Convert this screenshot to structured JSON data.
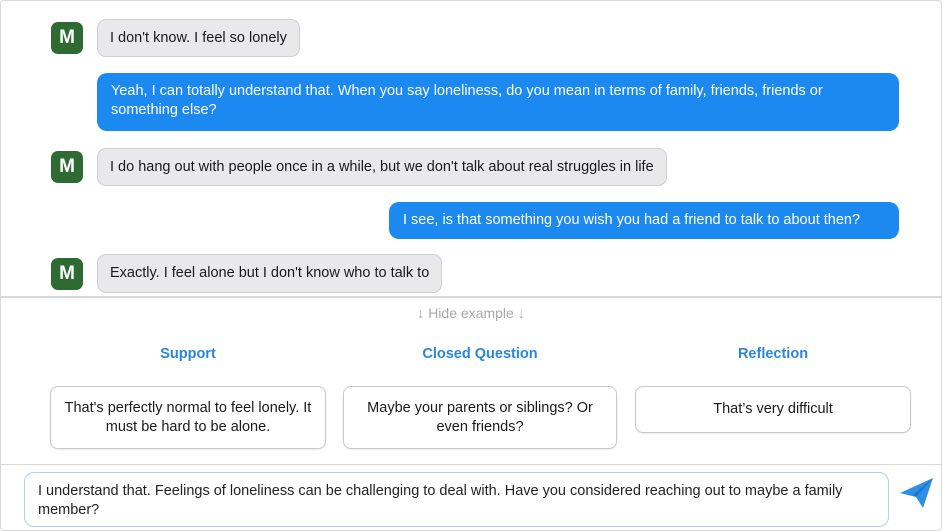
{
  "colors": {
    "avatar_bg": "#2e6b32",
    "outgoing_bubble": "#1c89f0",
    "incoming_bubble": "#e9e9eb",
    "strategy_title": "#2a86db",
    "send_icon": "#2c8fe8"
  },
  "chat": {
    "avatar_letter": "M",
    "messages": [
      {
        "sender": "client",
        "text": "I don't know. I feel so lonely"
      },
      {
        "sender": "counselor",
        "text": "Yeah, I can totally understand that. When you say loneliness, do you mean in terms of family, friends, friends or something else?"
      },
      {
        "sender": "client",
        "text": "I do hang out with people once in a while, but we don't talk about real struggles in life"
      },
      {
        "sender": "counselor",
        "text": "I see, is that something you wish you had a friend to talk to about then?"
      },
      {
        "sender": "client",
        "text": "Exactly. I feel alone but I don't know who to talk to"
      }
    ]
  },
  "examples": {
    "toggle_label": "Hide example",
    "toggle_icon": "arrow-down",
    "strategies": [
      {
        "title": "Support",
        "suggestion": "That's perfectly normal to feel lonely. It must be hard to be alone."
      },
      {
        "title": "Closed Question",
        "suggestion": "Maybe your parents or siblings? Or even friends?"
      },
      {
        "title": "Reflection",
        "suggestion": "That’s very difficult"
      }
    ]
  },
  "composer": {
    "value": "I understand that. Feelings of loneliness can be challenging to deal with. Have you considered reaching out to maybe a family member?",
    "send_icon": "paper-plane"
  }
}
